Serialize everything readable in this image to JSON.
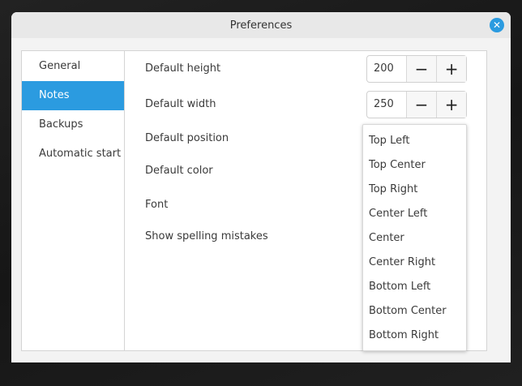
{
  "window": {
    "title": "Preferences"
  },
  "sidebar": {
    "items": [
      {
        "label": "General"
      },
      {
        "label": "Notes"
      },
      {
        "label": "Backups"
      },
      {
        "label": "Automatic start"
      }
    ],
    "active": "Notes"
  },
  "settings": {
    "default_height": {
      "label": "Default height",
      "value": "200"
    },
    "default_width": {
      "label": "Default width",
      "value": "250"
    },
    "default_position": {
      "label": "Default position"
    },
    "default_color": {
      "label": "Default color"
    },
    "font": {
      "label": "Font"
    },
    "spelling": {
      "label": "Show spelling mistakes"
    }
  },
  "spin": {
    "minus": "−",
    "plus": "+"
  },
  "position_options": [
    "Top Left",
    "Top Center",
    "Top Right",
    "Center Left",
    "Center",
    "Center Right",
    "Bottom Left",
    "Bottom Center",
    "Bottom Right"
  ],
  "colors": {
    "accent": "#2b9be0"
  }
}
